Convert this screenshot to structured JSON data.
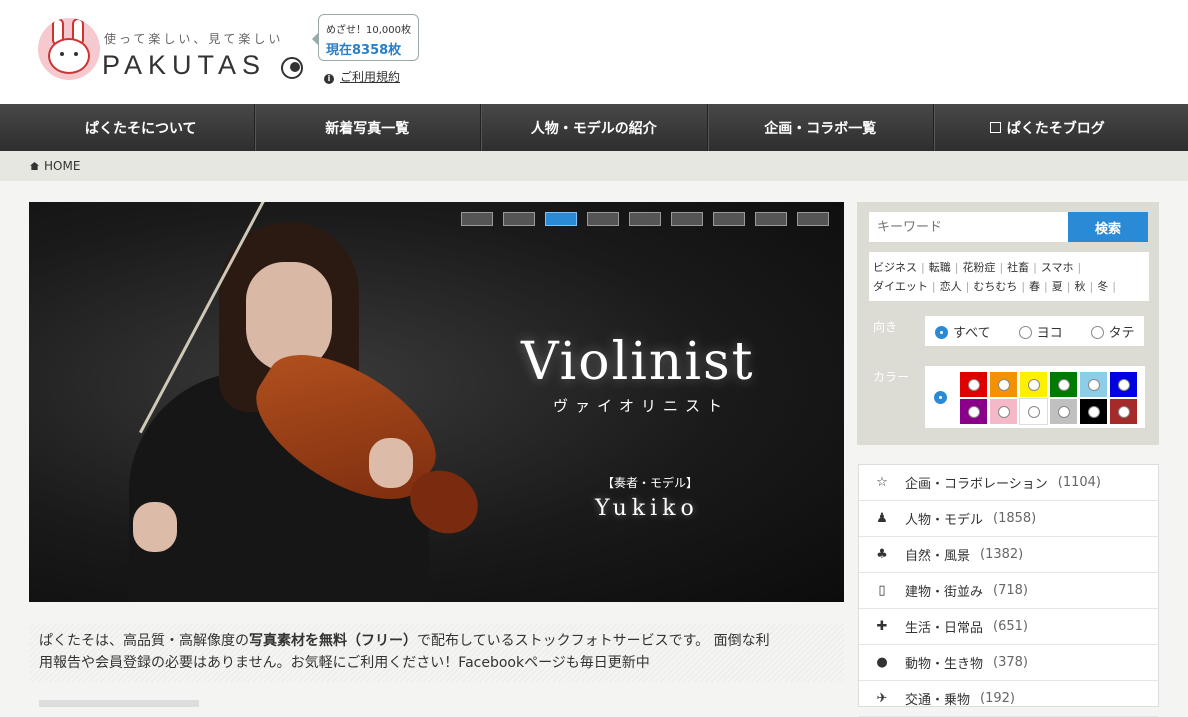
{
  "header": {
    "tagline": "使って楽しい、見て楽しい",
    "logo_text": "PAKUTAS",
    "counter_goal": "めざせ！10,000枚",
    "counter_now": "現在8358枚",
    "terms_label": "ご利用規約"
  },
  "nav": {
    "items": [
      {
        "label": "ぱくたそについて"
      },
      {
        "label": "新着写真一覧"
      },
      {
        "label": "人物・モデルの紹介"
      },
      {
        "label": "企画・コラボ一覧"
      },
      {
        "label": "ぱくたそブログ"
      }
    ]
  },
  "breadcrumb": {
    "home": "HOME"
  },
  "hero": {
    "title": "Violinist",
    "subtitle": "ヴァイオリニスト",
    "model_tag": "【奏者・モデル】",
    "model_name": "Yukiko",
    "active_slide": 3,
    "slide_count": 9
  },
  "intro": {
    "part1": "ぱくたそは、高品質・高解像度の",
    "bold": "写真素材を無料（フリー）",
    "part2": "で配布しているストックフォトサービスです。 面倒な利",
    "line2": "用報告や会員登録の必要はありません。お気軽にご利用ください！Facebookページも毎日更新中"
  },
  "search": {
    "placeholder": "キーワード",
    "button": "検索"
  },
  "tags": [
    "ビジネス",
    "転職",
    "花粉症",
    "社畜",
    "スマホ",
    "ダイエット",
    "恋人",
    "むちむち",
    "春",
    "夏",
    "秋",
    "冬"
  ],
  "orientation": {
    "label": "向き",
    "options": [
      "すべて",
      "ヨコ",
      "タテ"
    ],
    "selected": "すべて"
  },
  "color_filter": {
    "label": "カラー",
    "swatches": [
      "#e00000",
      "#f29200",
      "#fff000",
      "#007a00",
      "#8ccde8",
      "#0000e0",
      "#8b008b",
      "#f5b8c6",
      "#ffffff",
      "#c0c0c0",
      "#000000",
      "#a52a2a"
    ]
  },
  "categories": [
    {
      "icon": "star-icon",
      "label": "企画・コラボレーション",
      "count": "(1104)"
    },
    {
      "icon": "person-icon",
      "label": "人物・モデル",
      "count": "(1858)"
    },
    {
      "icon": "tree-icon",
      "label": "自然・風景",
      "count": "(1382)"
    },
    {
      "icon": "building-icon",
      "label": "建物・街並み",
      "count": "(718)"
    },
    {
      "icon": "puzzle-icon",
      "label": "生活・日常品",
      "count": "(651)"
    },
    {
      "icon": "globe-icon",
      "label": "動物・生き物",
      "count": "(378)"
    },
    {
      "icon": "plane-icon",
      "label": "交通・乗物",
      "count": "(192)"
    }
  ],
  "colors": {
    "accent": "#2a8ad6",
    "nav_bg": "#383838"
  }
}
